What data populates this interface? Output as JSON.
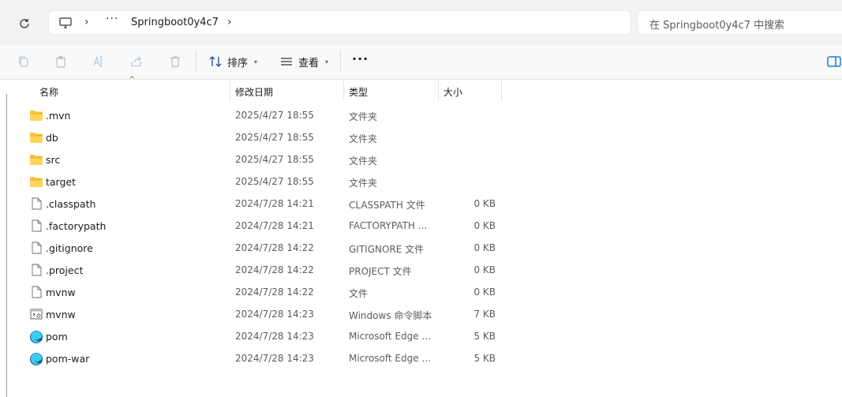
{
  "address": {
    "overflow": "···",
    "crumb": "Springboot0y4c7",
    "sep": "›"
  },
  "search": {
    "placeholder": "在 Springboot0y4c7 中搜索"
  },
  "toolbar": {
    "sort_label": "排序",
    "view_label": "查看",
    "more_label": "···"
  },
  "columns": {
    "name": "名称",
    "date": "修改日期",
    "type": "类型",
    "size": "大小"
  },
  "files": [
    {
      "name": ".mvn",
      "date": "2025/4/27 18:55",
      "type": "文件夹",
      "size": "",
      "icon": "folder-icon"
    },
    {
      "name": "db",
      "date": "2025/4/27 18:55",
      "type": "文件夹",
      "size": "",
      "icon": "folder-icon"
    },
    {
      "name": "src",
      "date": "2025/4/27 18:55",
      "type": "文件夹",
      "size": "",
      "icon": "folder-icon"
    },
    {
      "name": "target",
      "date": "2025/4/27 18:55",
      "type": "文件夹",
      "size": "",
      "icon": "folder-icon"
    },
    {
      "name": ".classpath",
      "date": "2024/7/28 14:21",
      "type": "CLASSPATH 文件",
      "size": "0 KB",
      "icon": "file-icon"
    },
    {
      "name": ".factorypath",
      "date": "2024/7/28 14:21",
      "type": "FACTORYPATH ...",
      "size": "0 KB",
      "icon": "file-icon"
    },
    {
      "name": ".gitignore",
      "date": "2024/7/28 14:22",
      "type": "GITIGNORE 文件",
      "size": "0 KB",
      "icon": "file-icon"
    },
    {
      "name": ".project",
      "date": "2024/7/28 14:22",
      "type": "PROJECT 文件",
      "size": "0 KB",
      "icon": "file-icon"
    },
    {
      "name": "mvnw",
      "date": "2024/7/28 14:22",
      "type": "文件",
      "size": "0 KB",
      "icon": "file-icon"
    },
    {
      "name": "mvnw",
      "date": "2024/7/28 14:23",
      "type": "Windows 命令脚本",
      "size": "7 KB",
      "icon": "cmd-script-icon"
    },
    {
      "name": "pom",
      "date": "2024/7/28 14:23",
      "type": "Microsoft Edge ...",
      "size": "5 KB",
      "icon": "edge-icon"
    },
    {
      "name": "pom-war",
      "date": "2024/7/28 14:23",
      "type": "Microsoft Edge ...",
      "size": "5 KB",
      "icon": "edge-icon"
    }
  ],
  "colors": {
    "folder": "#f4c542",
    "folder_dark": "#e0a81e",
    "accent": "#0067c0",
    "edge_a": "#0c59a4",
    "edge_b": "#3ccbf4",
    "edge_c": "#4cc35c"
  }
}
